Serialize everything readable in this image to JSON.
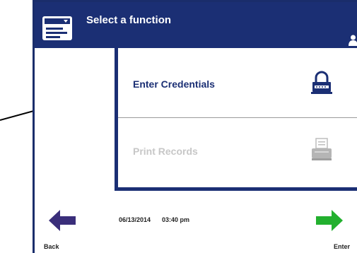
{
  "header": {
    "title": "Select a function",
    "menu_icon": "menu-card-icon",
    "user_icon": "user-icon"
  },
  "functions": [
    {
      "label": "Enter Credentials",
      "icon": "lock-icon",
      "enabled": true
    },
    {
      "label": "Print Records",
      "icon": "printer-icon",
      "enabled": false
    }
  ],
  "footer": {
    "date": "06/13/2014",
    "time": "03:40 pm",
    "back_label": "Back",
    "enter_label": "Enter"
  },
  "colors": {
    "brand_navy": "#1b2f74",
    "back_arrow": "#3a2e7a",
    "enter_arrow": "#22b02e",
    "disabled_text": "#c7c7c7"
  }
}
